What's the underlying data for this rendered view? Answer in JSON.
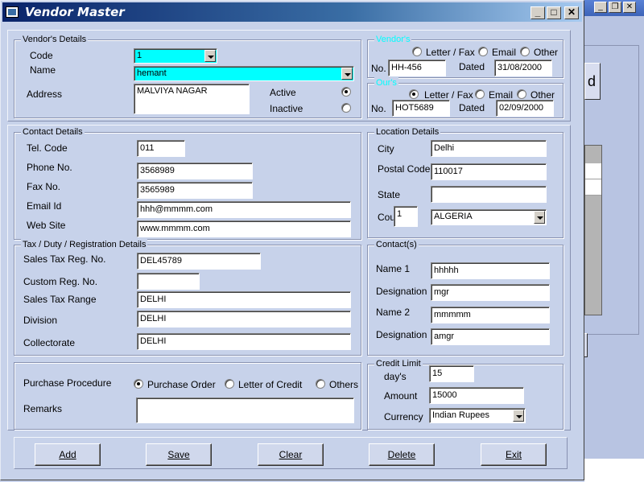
{
  "window": {
    "title": "Vendor Master",
    "min": "_",
    "max": "□",
    "close": "✕"
  },
  "bg_window": {
    "partial_button": "d"
  },
  "vendor_details": {
    "title": "Vendor's Details",
    "code_label": "Code",
    "code_value": "1",
    "name_label": "Name",
    "name_value": "hemant",
    "address_label": "Address",
    "address_value": "MALVIYA NAGAR",
    "active_label": "Active",
    "inactive_label": "Inactive",
    "status": "Active"
  },
  "vendors_ref": {
    "title": "Vendor's",
    "opt1": "Letter / Fax",
    "opt2": "Email",
    "opt3": "Other",
    "no_label": "No.",
    "no_value": "HH-456",
    "dated_label": "Dated",
    "dated_value": "31/08/2000"
  },
  "ours_ref": {
    "title": "Our's",
    "opt1": "Letter / Fax",
    "opt2": "Email",
    "opt3": "Other",
    "selected": "Letter / Fax",
    "no_label": "No.",
    "no_value": "HOT5689",
    "dated_label": "Dated",
    "dated_value": "02/09/2000"
  },
  "contact_details": {
    "title": "Contact Details",
    "tel_label": "Tel. Code",
    "tel_value": "011",
    "phone_label": "Phone No.",
    "phone_value": "3568989",
    "fax_label": "Fax No.",
    "fax_value": " 3565989",
    "email_label": "Email Id",
    "email_value": "hhh@mmmm.com",
    "web_label": "Web Site",
    "web_value": "www.mmmm.com"
  },
  "location_details": {
    "title": "Location Details",
    "city_label": "City",
    "city_value": "Delhi",
    "postal_label": "Postal Code",
    "postal_value": "110017",
    "state_label": "State",
    "state_value": "",
    "country_label": "Cou",
    "country_code": "1",
    "country_value": "ALGERIA"
  },
  "tax_details": {
    "title": "Tax / Duty / Registration Details",
    "sales_tax_label": "Sales Tax Reg. No.",
    "sales_tax_value": "DEL45789",
    "custom_label": "Custom Reg. No.",
    "custom_value": "",
    "range_label": "Sales Tax Range",
    "range_value": "DELHI",
    "division_label": "Division",
    "division_value": "DELHI",
    "collectorate_label": "Collectorate",
    "collectorate_value": "DELHI"
  },
  "contacts": {
    "title": "Contact(s)",
    "name1_label": "Name 1",
    "name1_value": "hhhhh",
    "desig1_label": "Designation",
    "desig1_value": "mgr",
    "name2_label": "Name 2",
    "name2_value": "mmmmm",
    "desig2_label": "Designation",
    "desig2_value": "amgr"
  },
  "purchase": {
    "procedure_label": "Purchase Procedure",
    "opt1": "Purchase Order",
    "opt2": "Letter of Credit",
    "opt3": "Others",
    "selected": "Purchase Order",
    "remarks_label": "Remarks",
    "remarks_value": ""
  },
  "credit_limit": {
    "title": "Credit Limit",
    "days_label": "day's",
    "days_value": "15",
    "amount_label": "Amount",
    "amount_value": "15000",
    "currency_label": "Currency",
    "currency_value": "Indian Rupees"
  },
  "buttons": {
    "add": "Add",
    "save": "Save",
    "clear": "Clear",
    "delete": "Delete",
    "exit": "Exit"
  }
}
